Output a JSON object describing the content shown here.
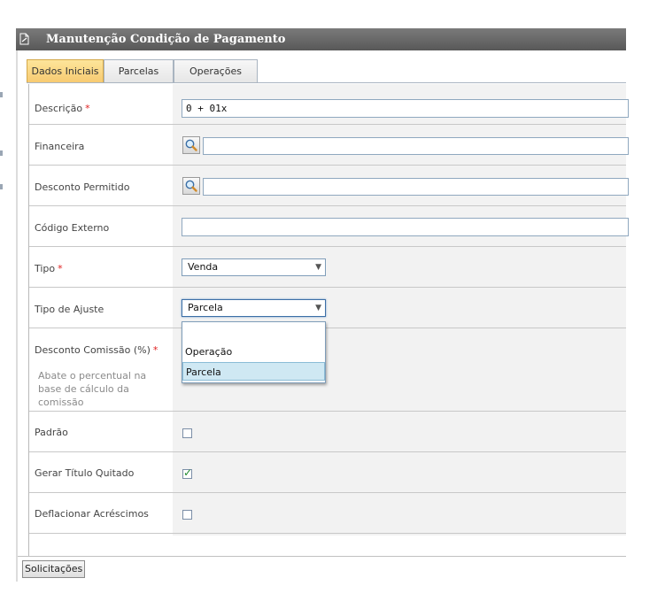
{
  "window": {
    "title": "Manutenção Condição de Pagamento"
  },
  "tabs": [
    {
      "label": "Dados Iniciais",
      "active": true
    },
    {
      "label": "Parcelas",
      "active": false
    },
    {
      "label": "Operações",
      "active": false
    }
  ],
  "form": {
    "descricao": {
      "label": "Descrição",
      "required_mark": "*",
      "value": "0 + 01x"
    },
    "financeira": {
      "label": "Financeira",
      "value": ""
    },
    "desconto_permitido": {
      "label": "Desconto Permitido",
      "value": ""
    },
    "codigo_externo": {
      "label": "Código Externo",
      "value": ""
    },
    "tipo": {
      "label": "Tipo",
      "required_mark": "*",
      "value": "Venda"
    },
    "tipo_ajuste": {
      "label": "Tipo de Ajuste",
      "value": "Parcela",
      "options": [
        "",
        "Operação",
        "Parcela"
      ]
    },
    "desconto_comissao": {
      "label": "Desconto Comissão (%)",
      "required_mark": "*",
      "help": "Abate o percentual na base de cálculo da comissão"
    },
    "padrao": {
      "label": "Padrão",
      "checked": false
    },
    "gerar_titulo_quitado": {
      "label": "Gerar Título Quitado",
      "checked": true
    },
    "deflacionar_acrescimos": {
      "label": "Deflacionar Acréscimos",
      "checked": false
    }
  },
  "footer": {
    "solicitacoes_label": "Solicitações"
  },
  "colors": {
    "title_bar": "#6a6a6a",
    "active_tab": "#f9d98a",
    "required": "#e02020",
    "dropdown_selected": "#cfe8f3",
    "check_mark": "#1f8a2e"
  }
}
